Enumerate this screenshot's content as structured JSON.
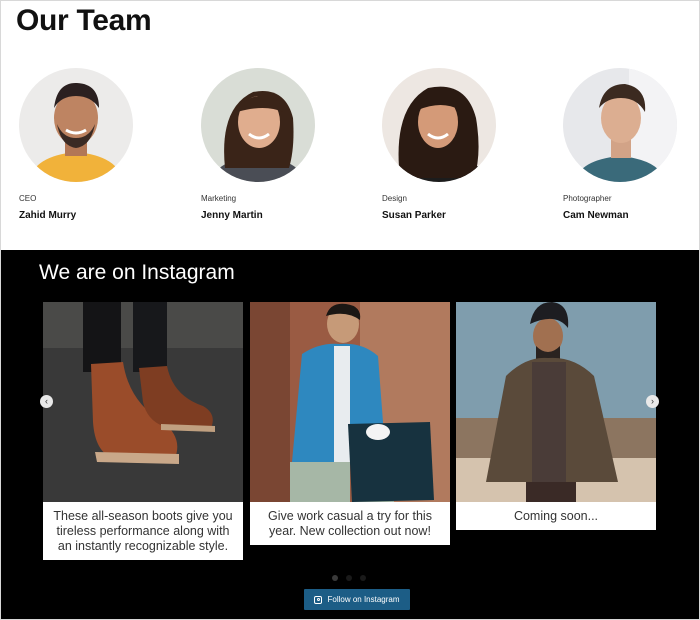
{
  "team": {
    "title": "Our Team",
    "members": [
      {
        "role": "CEO",
        "name": "Zahid Murry"
      },
      {
        "role": "Marketing",
        "name": "Jenny Martin"
      },
      {
        "role": "Design",
        "name": "Susan Parker"
      },
      {
        "role": "Photographer",
        "name": "Cam Newman"
      }
    ]
  },
  "instagram": {
    "title": "We are on Instagram",
    "posts": [
      {
        "caption": "These all-season boots give you tireless performance along with an instantly recognizable style."
      },
      {
        "caption": "Give work casual a try for this year. New collection out now!"
      },
      {
        "caption": "Coming soon..."
      }
    ],
    "prev_icon": "‹",
    "next_icon": "›",
    "follow_label": "Follow on Instagram"
  }
}
